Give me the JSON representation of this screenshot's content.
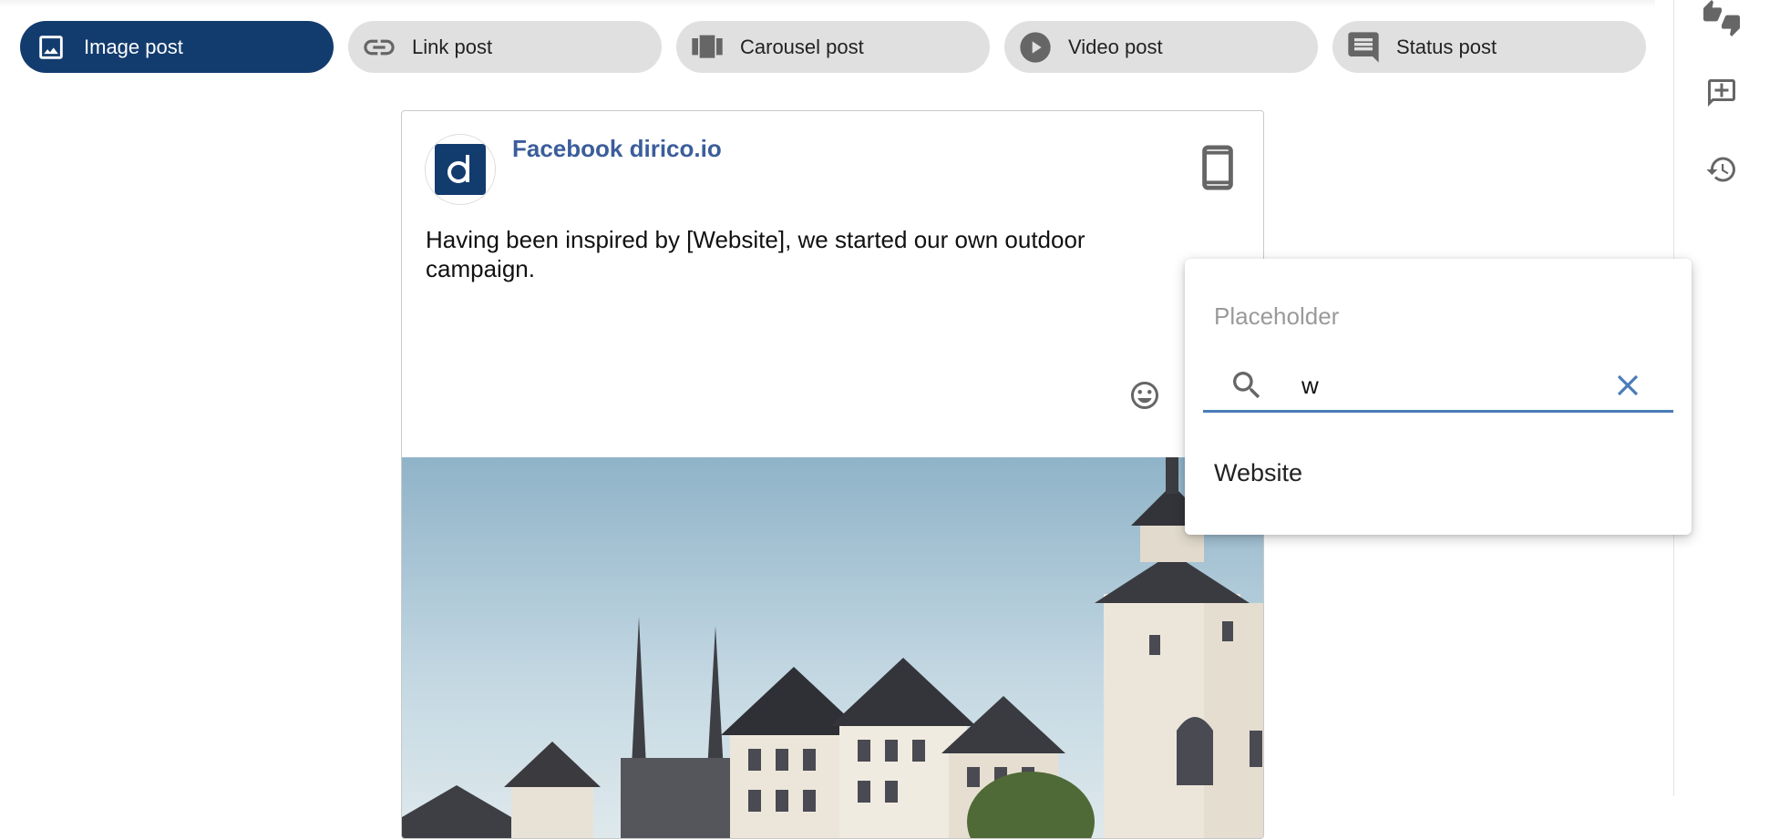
{
  "post_types": [
    {
      "label": "Image post",
      "icon": "image-icon",
      "active": true
    },
    {
      "label": "Link post",
      "icon": "link-icon",
      "active": false
    },
    {
      "label": "Carousel post",
      "icon": "carousel-icon",
      "active": false
    },
    {
      "label": "Video post",
      "icon": "play-icon",
      "active": false
    },
    {
      "label": "Status post",
      "icon": "comment-icon",
      "active": false
    }
  ],
  "rail": {
    "icons": [
      "thumbs-up-down-icon",
      "add-comment-icon",
      "history-icon"
    ]
  },
  "post": {
    "page_name": "Facebook dirico.io",
    "avatar_letter": "d",
    "text": "Having been inspired by [Website], we started our own outdoor campaign.",
    "device_icon": "mobile-phone-icon",
    "emoji_icon": "emoji-icon"
  },
  "placeholder_menu": {
    "title": "Placeholder",
    "search_value": "w",
    "options": [
      "Website"
    ]
  },
  "colors": {
    "active_chip": "#133c6e",
    "chip_bg": "#e0e0e0",
    "page_name": "#3b5d9a",
    "accent": "#4a7bb7"
  }
}
